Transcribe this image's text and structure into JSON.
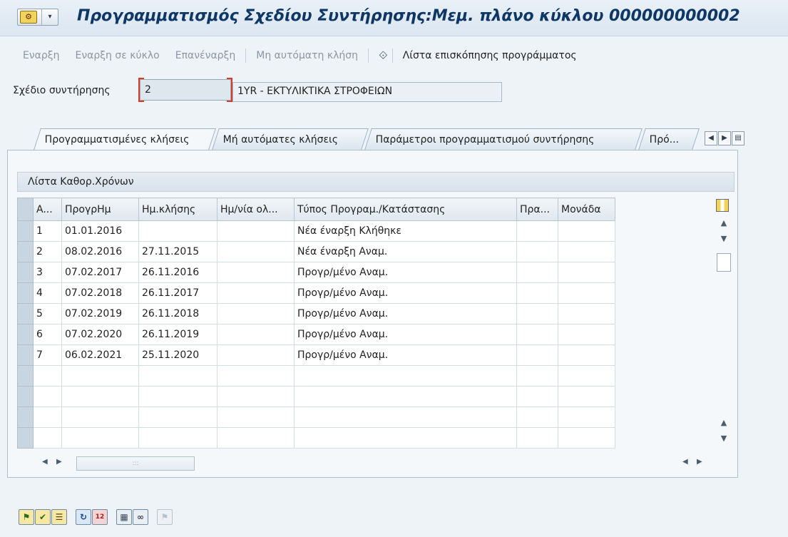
{
  "window": {
    "title": "Προγραμματισμός Σχεδίου Συντήρησης:Μεμ. πλάνο κύκλου 000000000002"
  },
  "toolbar": {
    "start": "Εναρξη",
    "start_in_cycle": "Εναρξη σε κύκλο",
    "restart": "Επανέναρξη",
    "manual_call": "Μη αυτόματη κλήση",
    "schedule_overview": "Λίστα επισκόπησης προγράμματος"
  },
  "plan": {
    "label": "Σχέδιο συντήρησης",
    "value": "2",
    "description": "1YR - ΕΚΤΥΛΙΚΤΙΚΑ ΣΤΡΟΦΕΙΩΝ"
  },
  "tabs": [
    {
      "label": "Προγραμματισμένες κλήσεις"
    },
    {
      "label": "Μή αυτόματες κλήσεις"
    },
    {
      "label": "Παράμετροι προγραμματισμού συντήρησης"
    },
    {
      "label": "Πρό..."
    }
  ],
  "grid": {
    "title": "Λίστα Καθορ.Χρόνων",
    "columns": [
      "A...",
      "ΠρογρΗμ",
      "Ημ.κλήσης",
      "Ημ/νία ολ...",
      "Τύπος Προγραμ./Κατάστασης",
      "Πρα...",
      "Μονάδα"
    ],
    "rows": [
      [
        "1",
        "01.01.2016",
        "",
        "",
        "Νέα έναρξη Κλήθηκε",
        "",
        ""
      ],
      [
        "2",
        "08.02.2016",
        "27.11.2015",
        "",
        "Νέα έναρξη Αναμ.",
        "",
        ""
      ],
      [
        "3",
        "07.02.2017",
        "26.11.2016",
        "",
        "Προγρ/μένο Αναμ.",
        "",
        ""
      ],
      [
        "4",
        "07.02.2018",
        "26.11.2017",
        "",
        "Προγρ/μένο Αναμ.",
        "",
        ""
      ],
      [
        "5",
        "07.02.2019",
        "26.11.2018",
        "",
        "Προγρ/μένο Αναμ.",
        "",
        ""
      ],
      [
        "6",
        "07.02.2020",
        "26.11.2019",
        "",
        "Προγρ/μένο Αναμ.",
        "",
        ""
      ],
      [
        "7",
        "06.02.2021",
        "25.11.2020",
        "",
        "Προγρ/μένο Αναμ.",
        "",
        ""
      ],
      [
        "",
        "",
        "",
        "",
        "",
        "",
        ""
      ],
      [
        "",
        "",
        "",
        "",
        "",
        "",
        ""
      ],
      [
        "",
        "",
        "",
        "",
        "",
        "",
        ""
      ],
      [
        "",
        "",
        "",
        "",
        "",
        "",
        ""
      ]
    ]
  },
  "icons": {
    "system_menu": "system-menu-icon",
    "overview": "overview-icon",
    "grid_config": "column-config-icon",
    "bottom": [
      "flag-icon",
      "check-flag-icon",
      "list-details-icon",
      "refresh-icon",
      "calendar-icon",
      "calculator-icon",
      "chain-link-icon",
      "disabled-flag-icon"
    ]
  }
}
